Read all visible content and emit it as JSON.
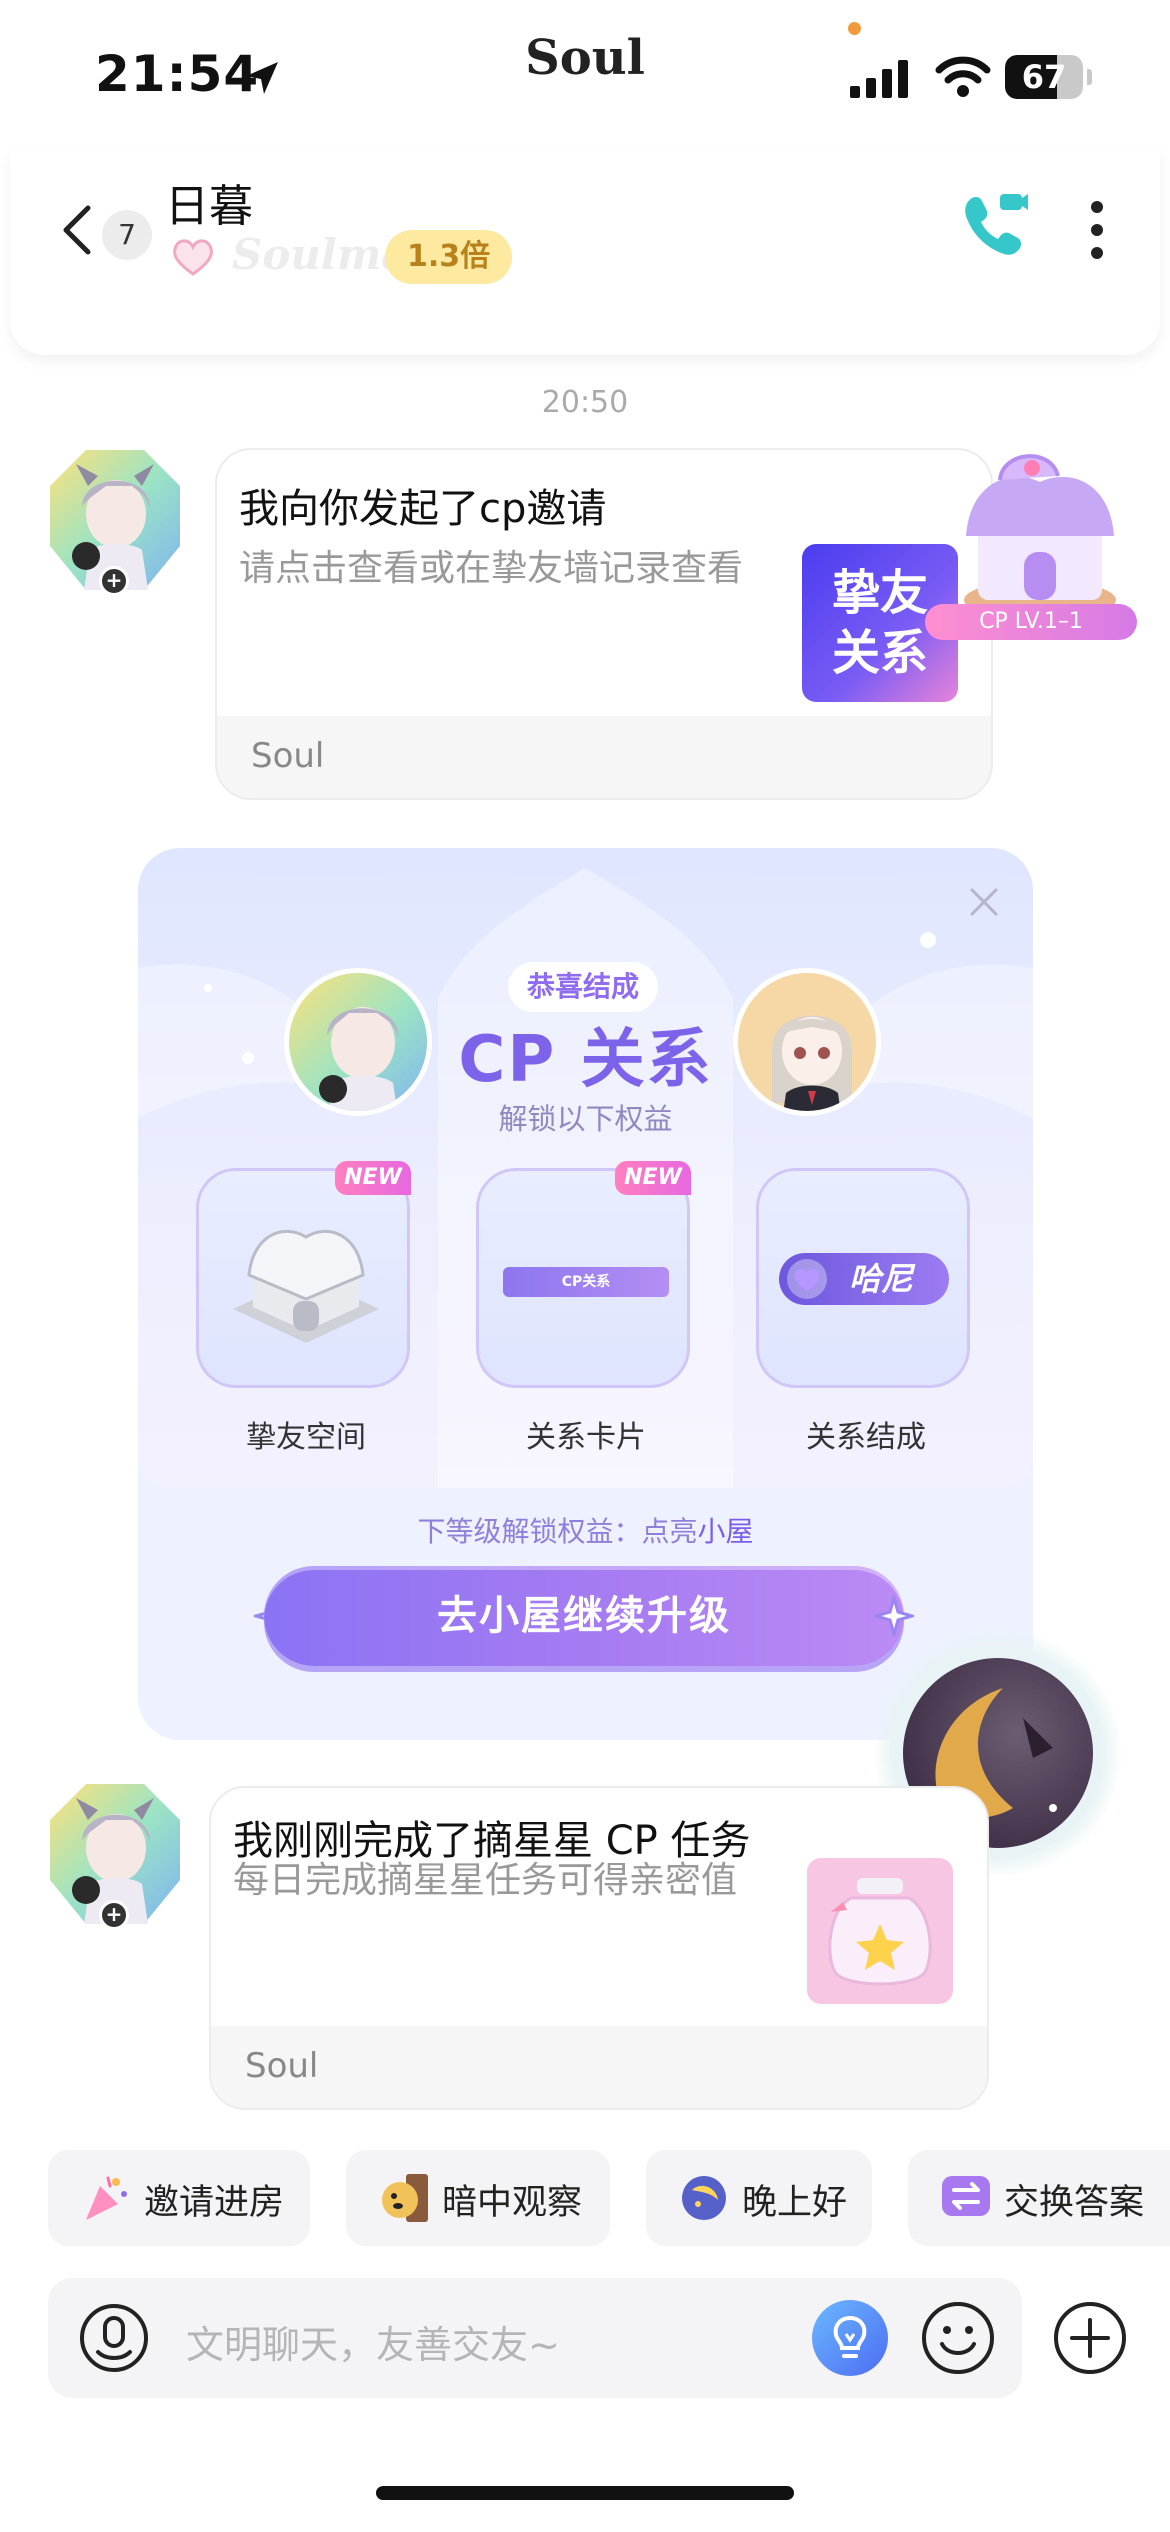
{
  "status_bar": {
    "time": "21:54",
    "app_brand": "Soul",
    "battery": 67
  },
  "header": {
    "unread_count": "7",
    "contact_name": "日暮",
    "soulmate_label": "Soulmate",
    "multiplier": "1.3倍"
  },
  "timestamp": "20:50",
  "messages": [
    {
      "title": "我向你发起了cp邀请",
      "description": "请点击查看或在挚友墙记录查看",
      "thumbnail_text": [
        "挚友",
        "关系"
      ],
      "footer": "Soul",
      "cp_level": "CP LV.1–1"
    },
    {
      "title": "我刚刚完成了摘星星 CP 任务",
      "description": "每日完成摘星星任务可得亲密值",
      "footer": "Soul"
    }
  ],
  "cp_panel": {
    "congrats": "恭喜结成",
    "title": "CP 关系",
    "subtitle": "解锁以下权益",
    "benefits": [
      {
        "label": "挚友空间",
        "tag": "NEW"
      },
      {
        "label": "关系卡片",
        "tag": "NEW",
        "card_text": "CP关系"
      },
      {
        "label": "关系结成",
        "pill_text": "哈尼"
      }
    ],
    "next_level_prefix": "下等级解锁权益：点亮",
    "next_level_highlight": "小屋",
    "upgrade_button": "去小屋继续升级"
  },
  "quick_replies": [
    "邀请进房",
    "暗中观察",
    "晚上好",
    "交换答案"
  ],
  "input": {
    "placeholder": "文明聊天，友善交友~"
  },
  "colors": {
    "accent_purple": "#7d63e9",
    "call_teal": "#35c7c9",
    "multiplier_bg": "#fde9a0"
  }
}
